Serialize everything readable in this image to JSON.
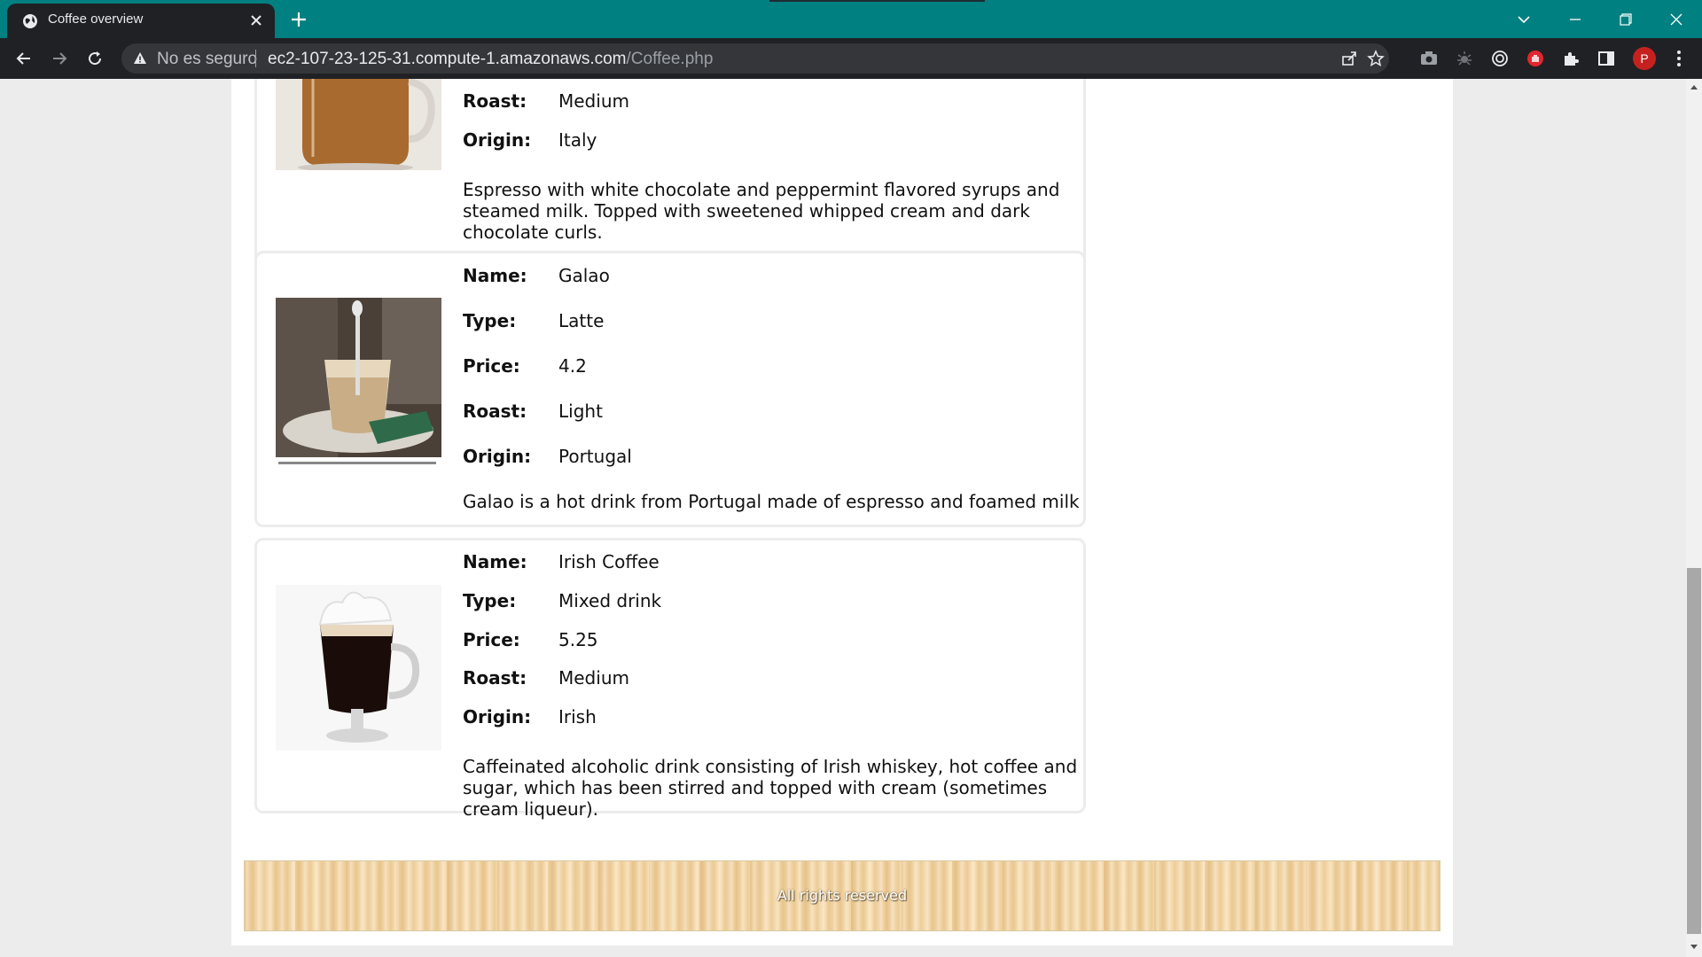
{
  "browser": {
    "tab_title": "Coffee overview",
    "security_label": "No es seguro",
    "url_host": "ec2-107-23-125-31.compute-1.amazonaws.com",
    "url_path": "/Coffee.php",
    "profile_initial": "P"
  },
  "labels": {
    "name": "Name:",
    "type": "Type:",
    "price": "Price:",
    "roast": "Roast:",
    "origin": "Origin:"
  },
  "coffees": [
    {
      "roast": "Medium",
      "origin": "Italy",
      "description": "Espresso with white chocolate and peppermint flavored syrups and steamed milk. Topped with sweetened whipped cream and dark chocolate curls.",
      "image": "mocha-mug-photo"
    },
    {
      "name": "Galao",
      "type": "Latte",
      "price": "4.2",
      "roast": "Light",
      "origin": "Portugal",
      "description": "Galao is a hot drink from Portugal made of espresso and foamed milk",
      "image": "galao-glass-photo"
    },
    {
      "name": "Irish Coffee",
      "type": "Mixed drink",
      "price": "5.25",
      "roast": "Medium",
      "origin": "Irish",
      "description": "Caffeinated alcoholic drink consisting of Irish whiskey, hot coffee and sugar, which has been stirred and topped with cream (sometimes cream liqueur).",
      "image": "irish-coffee-glass-photo"
    }
  ],
  "footer": {
    "text": "All rights reserved"
  },
  "colors": {
    "tabbar": "#008080",
    "toolbar": "#202124",
    "page_bg": "#ececec",
    "footer_wood": "#f3d6a5"
  }
}
